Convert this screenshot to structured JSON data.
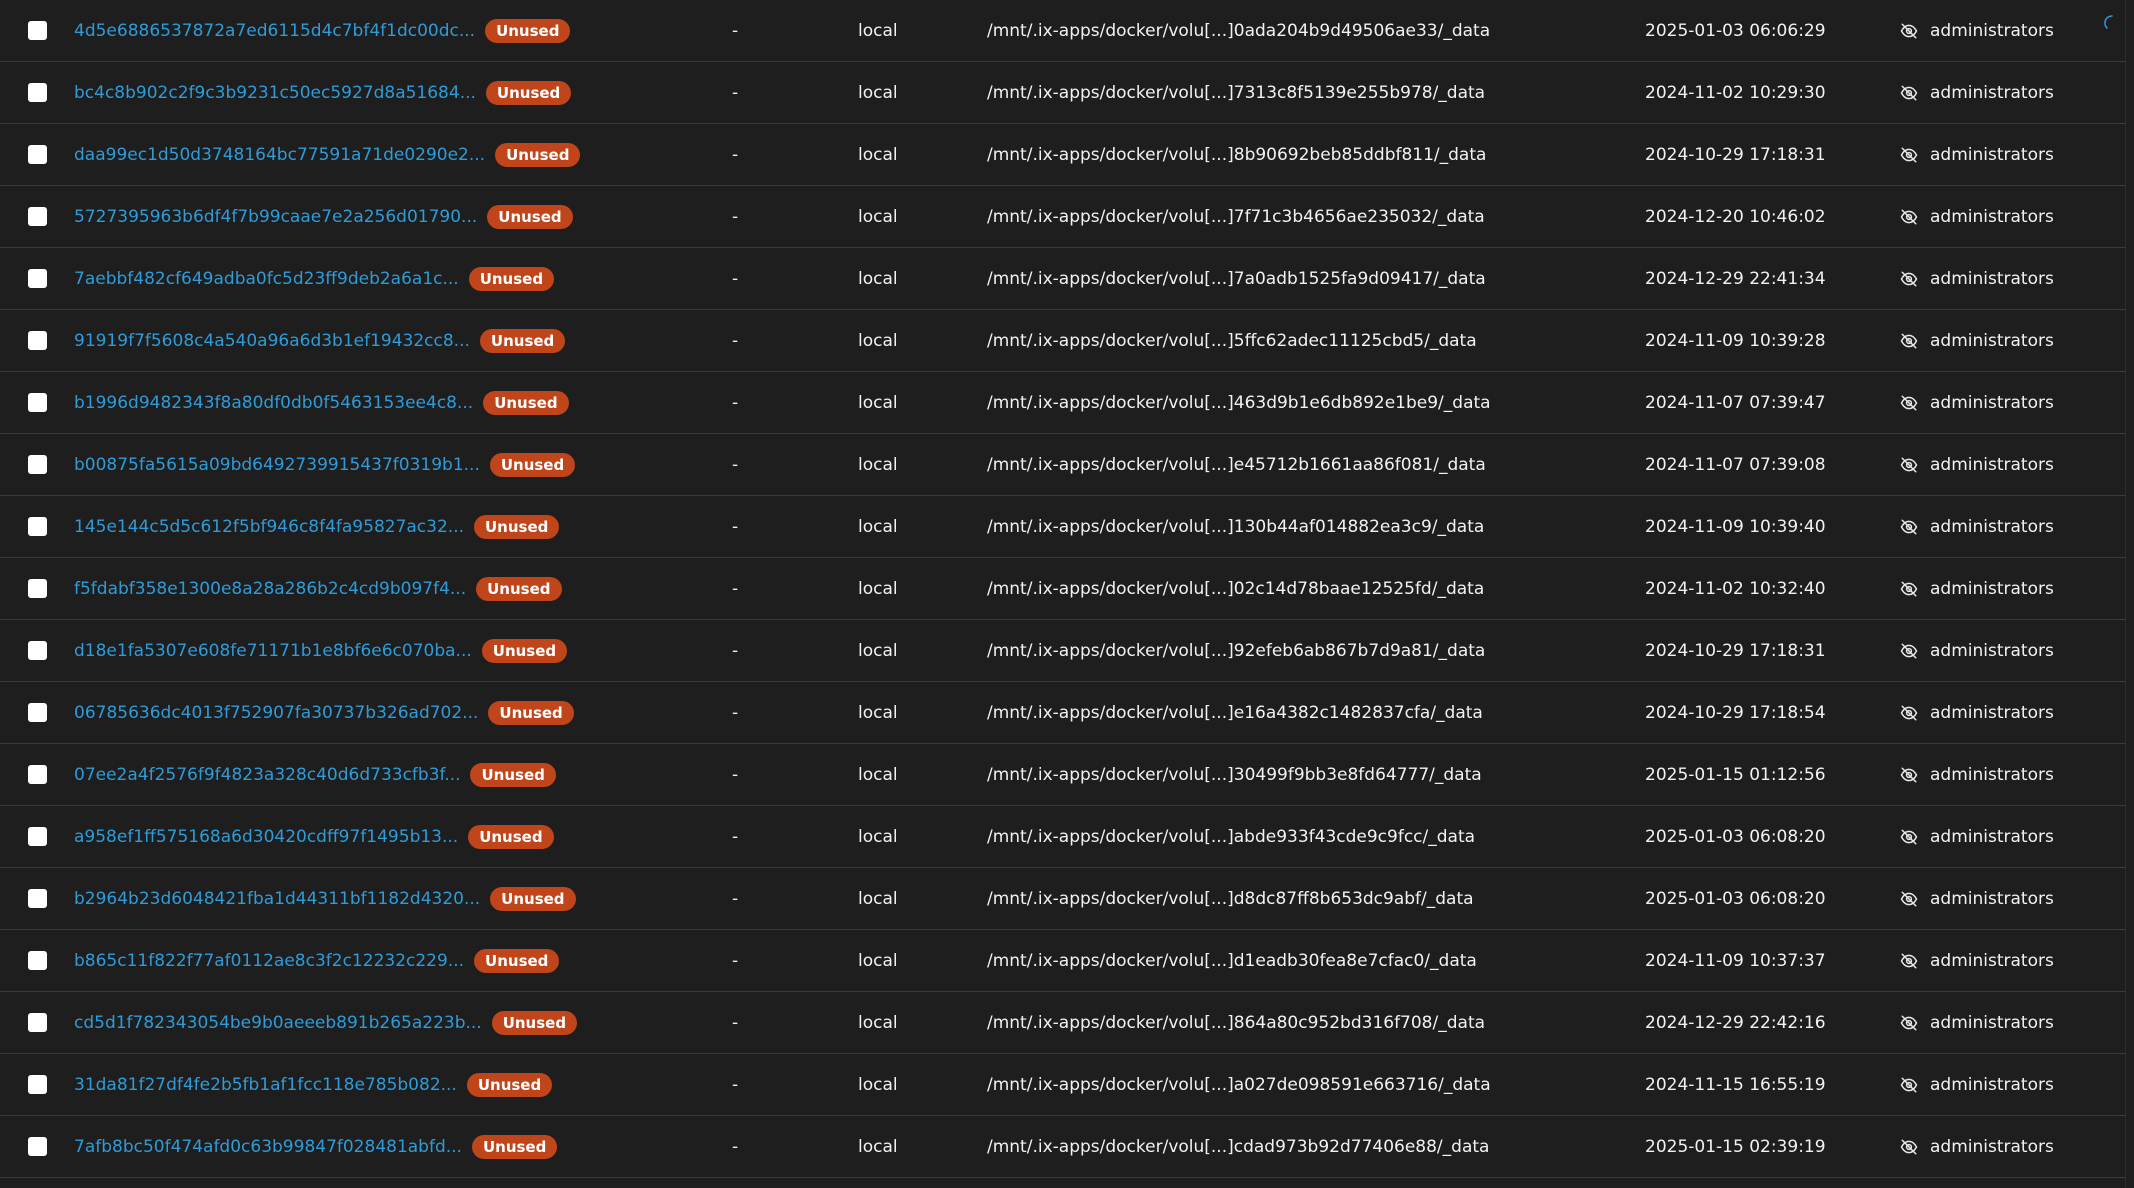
{
  "table": {
    "status_label": "Unused",
    "dash": "-",
    "owner_icon": "eye-slash-icon",
    "colors": {
      "background": "#1e1e1e",
      "link": "#2f9bd8",
      "badge": "#c0451a",
      "text": "#f2f2f2"
    },
    "rows": [
      {
        "name": "4d5e6886537872a7ed6115d4c7bf4f1dc00dc...",
        "driver": "local",
        "path": "/mnt/.ix-apps/docker/volu[...]0ada204b9d49506ae33/_data",
        "created": "2025-01-03 06:06:29",
        "owner": "administrators"
      },
      {
        "name": "bc4c8b902c2f9c3b9231c50ec5927d8a51684...",
        "driver": "local",
        "path": "/mnt/.ix-apps/docker/volu[...]7313c8f5139e255b978/_data",
        "created": "2024-11-02 10:29:30",
        "owner": "administrators"
      },
      {
        "name": "daa99ec1d50d3748164bc77591a71de0290e2...",
        "driver": "local",
        "path": "/mnt/.ix-apps/docker/volu[...]8b90692beb85ddbf811/_data",
        "created": "2024-10-29 17:18:31",
        "owner": "administrators"
      },
      {
        "name": "5727395963b6df4f7b99caae7e2a256d01790...",
        "driver": "local",
        "path": "/mnt/.ix-apps/docker/volu[...]7f71c3b4656ae235032/_data",
        "created": "2024-12-20 10:46:02",
        "owner": "administrators"
      },
      {
        "name": "7aebbf482cf649adba0fc5d23ff9deb2a6a1c...",
        "driver": "local",
        "path": "/mnt/.ix-apps/docker/volu[...]7a0adb1525fa9d09417/_data",
        "created": "2024-12-29 22:41:34",
        "owner": "administrators"
      },
      {
        "name": "91919f7f5608c4a540a96a6d3b1ef19432cc8...",
        "driver": "local",
        "path": "/mnt/.ix-apps/docker/volu[...]5ffc62adec11125cbd5/_data",
        "created": "2024-11-09 10:39:28",
        "owner": "administrators"
      },
      {
        "name": "b1996d9482343f8a80df0db0f5463153ee4c8...",
        "driver": "local",
        "path": "/mnt/.ix-apps/docker/volu[...]463d9b1e6db892e1be9/_data",
        "created": "2024-11-07 07:39:47",
        "owner": "administrators"
      },
      {
        "name": "b00875fa5615a09bd6492739915437f0319b1...",
        "driver": "local",
        "path": "/mnt/.ix-apps/docker/volu[...]e45712b1661aa86f081/_data",
        "created": "2024-11-07 07:39:08",
        "owner": "administrators"
      },
      {
        "name": "145e144c5d5c612f5bf946c8f4fa95827ac32...",
        "driver": "local",
        "path": "/mnt/.ix-apps/docker/volu[...]130b44af014882ea3c9/_data",
        "created": "2024-11-09 10:39:40",
        "owner": "administrators"
      },
      {
        "name": "f5fdabf358e1300e8a28a286b2c4cd9b097f4...",
        "driver": "local",
        "path": "/mnt/.ix-apps/docker/volu[...]02c14d78baae12525fd/_data",
        "created": "2024-11-02 10:32:40",
        "owner": "administrators"
      },
      {
        "name": "d18e1fa5307e608fe71171b1e8bf6e6c070ba...",
        "driver": "local",
        "path": "/mnt/.ix-apps/docker/volu[...]92efeb6ab867b7d9a81/_data",
        "created": "2024-10-29 17:18:31",
        "owner": "administrators"
      },
      {
        "name": "06785636dc4013f752907fa30737b326ad702...",
        "driver": "local",
        "path": "/mnt/.ix-apps/docker/volu[...]e16a4382c1482837cfa/_data",
        "created": "2024-10-29 17:18:54",
        "owner": "administrators"
      },
      {
        "name": "07ee2a4f2576f9f4823a328c40d6d733cfb3f...",
        "driver": "local",
        "path": "/mnt/.ix-apps/docker/volu[...]30499f9bb3e8fd64777/_data",
        "created": "2025-01-15 01:12:56",
        "owner": "administrators"
      },
      {
        "name": "a958ef1ff575168a6d30420cdff97f1495b13...",
        "driver": "local",
        "path": "/mnt/.ix-apps/docker/volu[...]abde933f43cde9c9fcc/_data",
        "created": "2025-01-03 06:08:20",
        "owner": "administrators"
      },
      {
        "name": "b2964b23d6048421fba1d44311bf1182d4320...",
        "driver": "local",
        "path": "/mnt/.ix-apps/docker/volu[...]d8dc87ff8b653dc9abf/_data",
        "created": "2025-01-03 06:08:20",
        "owner": "administrators"
      },
      {
        "name": "b865c11f822f77af0112ae8c3f2c12232c229...",
        "driver": "local",
        "path": "/mnt/.ix-apps/docker/volu[...]d1eadb30fea8e7cfac0/_data",
        "created": "2024-11-09 10:37:37",
        "owner": "administrators"
      },
      {
        "name": "cd5d1f782343054be9b0aeeeb891b265a223b...",
        "driver": "local",
        "path": "/mnt/.ix-apps/docker/volu[...]864a80c952bd316f708/_data",
        "created": "2024-12-29 22:42:16",
        "owner": "administrators"
      },
      {
        "name": "31da81f27df4fe2b5fb1af1fcc118e785b082...",
        "driver": "local",
        "path": "/mnt/.ix-apps/docker/volu[...]a027de098591e663716/_data",
        "created": "2024-11-15 16:55:19",
        "owner": "administrators"
      },
      {
        "name": "7afb8bc50f474afd0c63b99847f028481abfd...",
        "driver": "local",
        "path": "/mnt/.ix-apps/docker/volu[...]cdad973b92d77406e88/_data",
        "created": "2025-01-15 02:39:19",
        "owner": "administrators"
      }
    ]
  }
}
